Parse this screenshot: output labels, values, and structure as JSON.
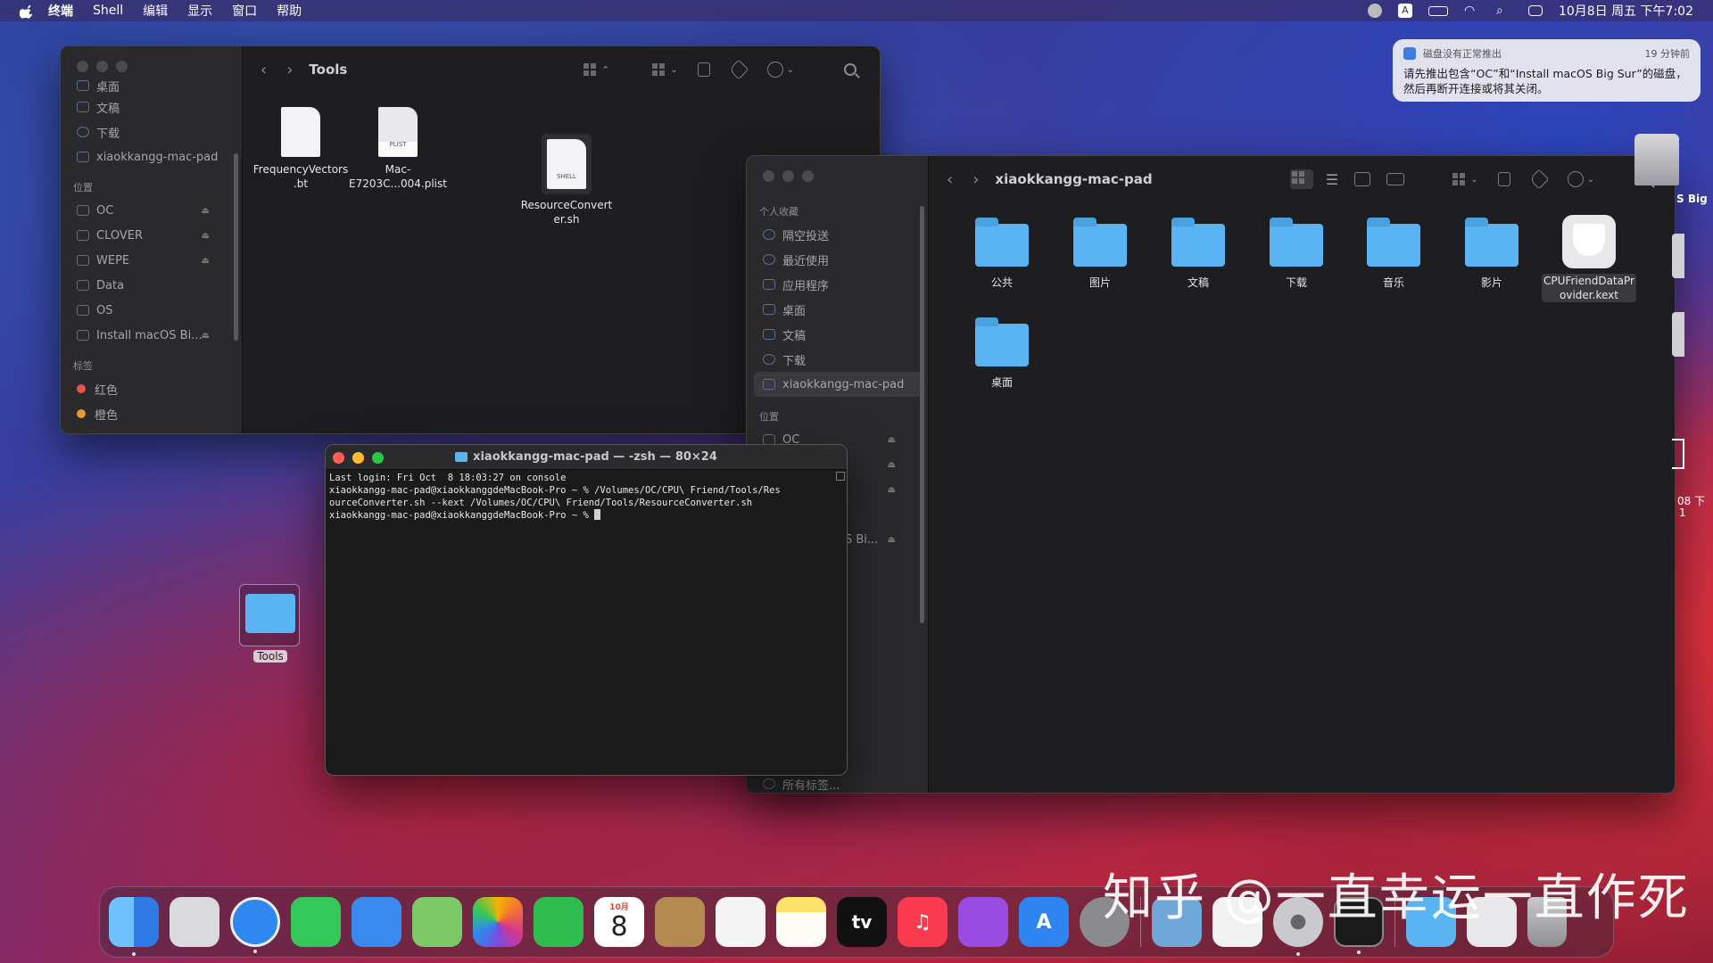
{
  "menubar": {
    "app": "终端",
    "items": [
      "Shell",
      "编辑",
      "显示",
      "窗口",
      "帮助"
    ],
    "clock": "10月8日 周五 下午7:02"
  },
  "finder_tools": {
    "title": "Tools",
    "sidebar_top": [
      "桌面",
      "文稿",
      "下载",
      "xiaokkangg-mac-pad"
    ],
    "locations_header": "位置",
    "locations": [
      "OC",
      "CLOVER",
      "WEPE",
      "Data",
      "OS",
      "Install macOS Bi..."
    ],
    "tags_header": "标签",
    "tags": [
      {
        "label": "红色",
        "color": "#e5534b"
      },
      {
        "label": "橙色",
        "color": "#e59a3b"
      }
    ],
    "files": [
      {
        "name": "FrequencyVectors\n.bt",
        "kind": ""
      },
      {
        "name": "Mac-\nE7203C...004.plist",
        "kind": "PLIST"
      },
      {
        "name": "ResourceConvert\ner.sh",
        "kind": "SHELL"
      }
    ]
  },
  "finder_home": {
    "title": "xiaokkangg-mac-pad",
    "favorites_header": "个人收藏",
    "favorites": [
      "隔空投送",
      "最近使用",
      "应用程序",
      "桌面",
      "文稿",
      "下载",
      "xiaokkangg-mac-pad"
    ],
    "locations_header": "位置",
    "locations": [
      "OC",
      "",
      "",
      "",
      "S Bi..."
    ],
    "all_tags": "所有标签...",
    "items": [
      {
        "name": "公共",
        "type": "folder"
      },
      {
        "name": "图片",
        "type": "folder"
      },
      {
        "name": "文稿",
        "type": "folder"
      },
      {
        "name": "下载",
        "type": "folder"
      },
      {
        "name": "音乐",
        "type": "folder"
      },
      {
        "name": "影片",
        "type": "folder"
      },
      {
        "name": "CPUFriendDataPr\novider.kext",
        "type": "kext"
      },
      {
        "name": "桌面",
        "type": "folder"
      }
    ]
  },
  "terminal": {
    "title": "xiaokkangg-mac-pad — -zsh — 80×24",
    "lines": [
      "Last login: Fri Oct  8 18:03:27 on console",
      "xiaokkangg-mac-pad@xiaokkanggdeMacBook-Pro ~ % /Volumes/OC/CPU\\ Friend/Tools/Res",
      "ourceConverter.sh --kext /Volumes/OC/CPU\\ Friend/Tools/ResourceConverter.sh",
      "xiaokkangg-mac-pad@xiaokkanggdeMacBook-Pro ~ % "
    ]
  },
  "notification": {
    "app": "磁盘没有正常推出",
    "time": "19 分钟前",
    "body": "请先推出包含“OC”和“Install macOS Big Sur”的磁盘，然后再断开连接或将其关闭。"
  },
  "desktop": {
    "tools_folder": "Tools",
    "right_fragments": [
      "S Big",
      "08 下",
      "1"
    ]
  },
  "dock": {
    "apps": [
      {
        "name": "finder-icon",
        "color": "#3d8ef0"
      },
      {
        "name": "launchpad-icon",
        "color": "#d9d9de"
      },
      {
        "name": "safari-icon",
        "color": "#2f87f0"
      },
      {
        "name": "messages-icon",
        "color": "#34c759"
      },
      {
        "name": "mail-icon",
        "color": "#3b8af0"
      },
      {
        "name": "maps-icon",
        "color": "#7dc96a"
      },
      {
        "name": "photos-icon",
        "color": "#f4b400"
      },
      {
        "name": "facetime-icon",
        "color": "#2fbd4f"
      },
      {
        "name": "calendar-icon",
        "color": "#ffffff"
      },
      {
        "name": "contacts-icon",
        "color": "#b48a52"
      },
      {
        "name": "reminders-icon",
        "color": "#f4f4f4"
      },
      {
        "name": "notes-icon",
        "color": "#fbe26a"
      },
      {
        "name": "tv-icon",
        "color": "#111111"
      },
      {
        "name": "music-icon",
        "color": "#fa3b4f"
      },
      {
        "name": "podcasts-icon",
        "color": "#9a4be0"
      },
      {
        "name": "appstore-icon",
        "color": "#2e84f0"
      },
      {
        "name": "system-preferences-icon",
        "color": "#8a8a8f"
      },
      {
        "name": "preview-icon",
        "color": "#6fa7d8"
      },
      {
        "name": "textedit-icon",
        "color": "#f2f2f2"
      },
      {
        "name": "disk-utility-icon",
        "color": "#9a9aa0"
      },
      {
        "name": "terminal-icon",
        "color": "#1a1a1a"
      },
      {
        "name": "downloads-stack-icon",
        "color": "#5bb4f2"
      },
      {
        "name": "documents-stack-icon",
        "color": "#e8e8ea"
      },
      {
        "name": "trash-icon",
        "color": "#b8b8bd"
      }
    ],
    "calendar_month": "10月",
    "calendar_day": "8",
    "tv_label": "tv"
  },
  "watermark": "知乎 @一直幸运一直作死"
}
